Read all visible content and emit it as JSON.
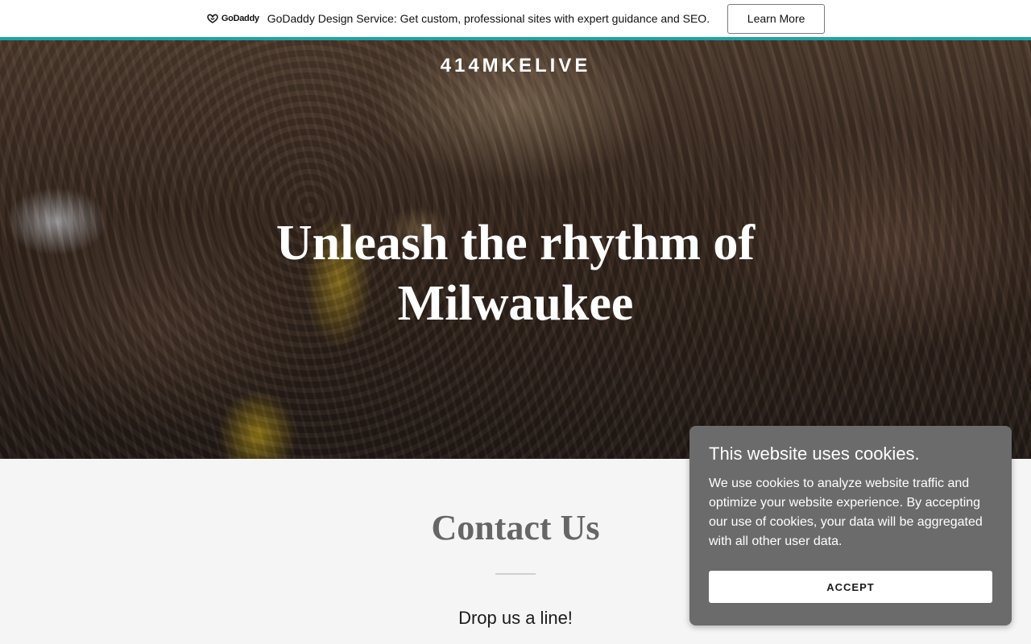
{
  "promo": {
    "logo_text": "GoDaddy",
    "message": "GoDaddy Design Service: Get custom, professional sites with expert guidance and SEO.",
    "button_label": "Learn More",
    "accent_color": "#1ba6a4"
  },
  "hero": {
    "brand": "414MKELIVE",
    "headline": "Unleash the rhythm of Milwaukee"
  },
  "contact": {
    "title": "Contact Us",
    "subtitle": "Drop us a line!"
  },
  "cookie_banner": {
    "title": "This website uses cookies.",
    "body": "We use cookies to analyze website traffic and optimize your website experience. By accepting our use of cookies, your data will be aggregated with all other user data.",
    "accept_label": "ACCEPT"
  }
}
